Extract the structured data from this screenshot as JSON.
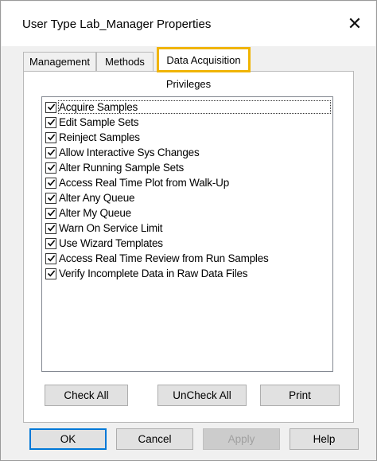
{
  "window": {
    "title": "User Type Lab_Manager Properties",
    "close_glyph": "✕"
  },
  "tabs": [
    {
      "label": "Management",
      "selected": false
    },
    {
      "label": "Methods",
      "selected": false
    },
    {
      "label": "Data Acquisition",
      "selected": true
    }
  ],
  "privileges": {
    "heading": "Privileges",
    "items": [
      {
        "label": "Acquire Samples",
        "checked": true
      },
      {
        "label": "Edit Sample Sets",
        "checked": true
      },
      {
        "label": "Reinject Samples",
        "checked": true
      },
      {
        "label": "Allow Interactive Sys Changes",
        "checked": true
      },
      {
        "label": "Alter Running Sample Sets",
        "checked": true
      },
      {
        "label": "Access Real Time Plot from Walk-Up",
        "checked": true
      },
      {
        "label": "Alter Any Queue",
        "checked": true
      },
      {
        "label": "Alter My Queue",
        "checked": true
      },
      {
        "label": "Warn On Service Limit",
        "checked": true
      },
      {
        "label": "Use Wizard Templates",
        "checked": true
      },
      {
        "label": "Access Real Time Review from Run Samples",
        "checked": true
      },
      {
        "label": "Verify Incomplete Data in Raw Data Files",
        "checked": true
      }
    ]
  },
  "panel_buttons": {
    "check_all": "Check All",
    "uncheck_all": "UnCheck All",
    "print": "Print"
  },
  "dialog_buttons": {
    "ok": "OK",
    "cancel": "Cancel",
    "apply": "Apply",
    "help": "Help"
  },
  "colors": {
    "highlight": "#f0b400",
    "default_button_border": "#0078d7"
  }
}
